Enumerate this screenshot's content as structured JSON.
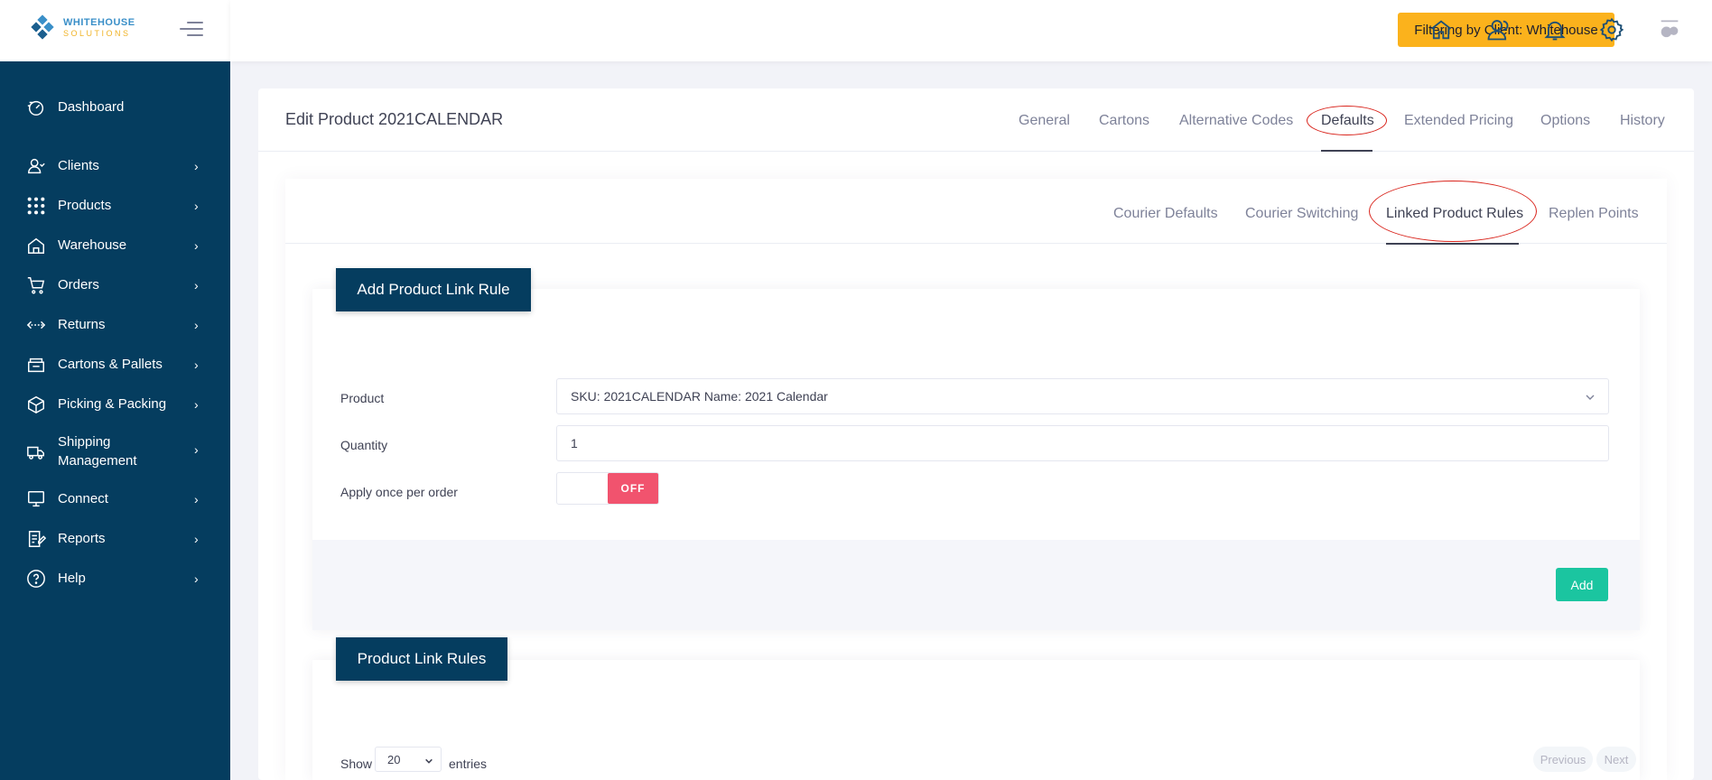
{
  "app": {
    "logo_line1": "WHITEHOUSE",
    "logo_line2": "SOLUTIONS"
  },
  "topbar": {
    "filter_label": "Filtering by Client: Whitehouse",
    "icons": [
      "home-icon",
      "users-icon",
      "bell-icon",
      "settings-icon",
      "user-avatar-icon"
    ]
  },
  "sidebar": {
    "items": [
      {
        "label": "Dashboard",
        "icon": "dashboard-icon",
        "has_submenu": false
      },
      {
        "label": "Clients",
        "icon": "clients-icon",
        "has_submenu": true
      },
      {
        "label": "Products",
        "icon": "grid-icon",
        "has_submenu": true
      },
      {
        "label": "Warehouse",
        "icon": "warehouse-icon",
        "has_submenu": true
      },
      {
        "label": "Orders",
        "icon": "cart-icon",
        "has_submenu": true
      },
      {
        "label": "Returns",
        "icon": "returns-icon",
        "has_submenu": true
      },
      {
        "label": "Cartons & Pallets",
        "icon": "pallet-icon",
        "has_submenu": true
      },
      {
        "label": "Picking & Packing",
        "icon": "box-icon",
        "has_submenu": true
      },
      {
        "label": "Shipping",
        "label2": "Management",
        "icon": "truck-icon",
        "has_submenu": true
      },
      {
        "label": "Connect",
        "icon": "connect-icon",
        "has_submenu": true
      },
      {
        "label": "Reports",
        "icon": "reports-icon",
        "has_submenu": true
      },
      {
        "label": "Help",
        "icon": "help-icon",
        "has_submenu": true
      }
    ],
    "chevron": "›"
  },
  "page": {
    "title": "Edit Product 2021CALENDAR",
    "tabs": [
      {
        "label": "General"
      },
      {
        "label": "Cartons"
      },
      {
        "label": "Alternative Codes"
      },
      {
        "label": "Defaults",
        "active": true
      },
      {
        "label": "Extended Pricing"
      },
      {
        "label": "Options"
      },
      {
        "label": "History"
      }
    ],
    "subtabs": [
      {
        "label": "Courier Defaults"
      },
      {
        "label": "Courier Switching"
      },
      {
        "label": "Linked Product Rules",
        "active": true
      },
      {
        "label": "Replen Points"
      }
    ]
  },
  "add_rule": {
    "heading": "Add Product Link Rule",
    "product_label": "Product",
    "product_value": "SKU: 2021CALENDAR Name: 2021 Calendar",
    "quantity_label": "Quantity",
    "quantity_value": "1",
    "apply_once_label": "Apply once per order",
    "apply_once_state": "OFF",
    "add_button": "Add"
  },
  "rules_list": {
    "heading": "Product Link Rules",
    "show_label": "Show",
    "entries_value": "20",
    "entries_label": "entries",
    "previous": "Previous",
    "next": "Next"
  },
  "colors": {
    "sidebar": "#053d5f",
    "filter_badge": "#fbb21c",
    "add_button": "#1bc5a0",
    "toggle_off": "#f1536e",
    "annotation": "#d9241c"
  }
}
